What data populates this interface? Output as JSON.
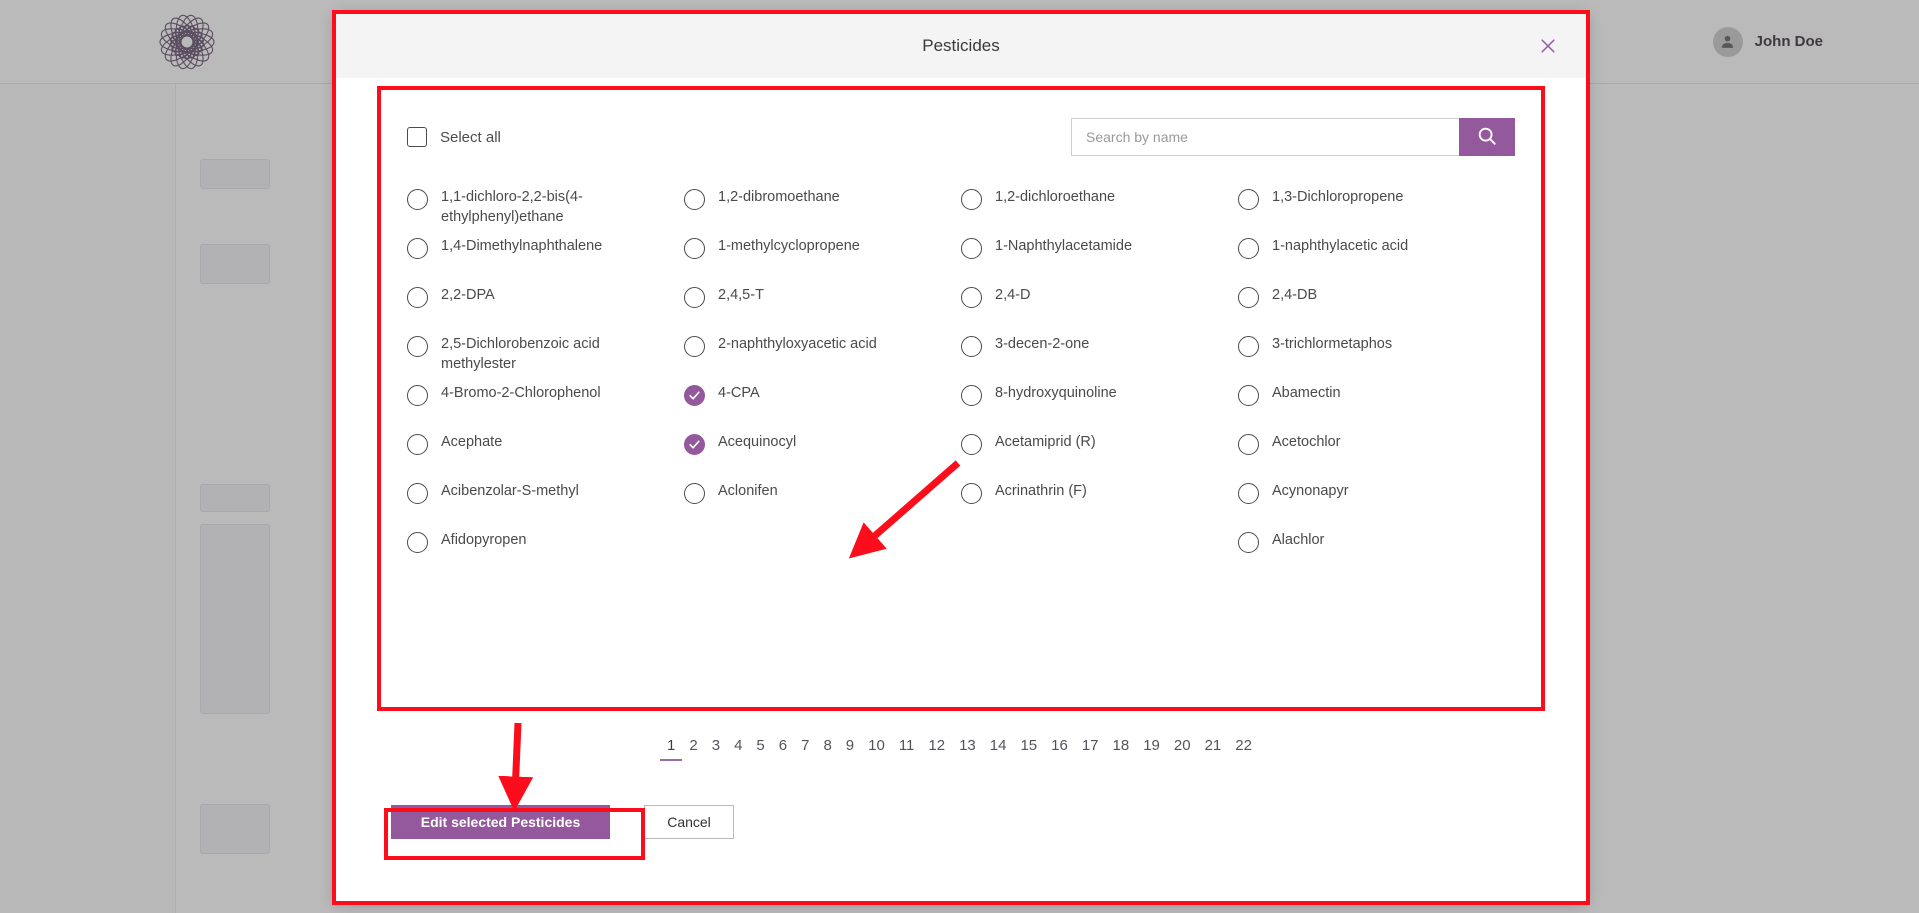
{
  "background": {
    "logo_icon": "flower-mandala-logo",
    "user": {
      "name": "John Doe",
      "avatar_icon": "person-avatar-icon"
    }
  },
  "modal": {
    "title": "Pesticides",
    "close_icon": "close-icon",
    "toolbar": {
      "select_all_label": "Select all",
      "select_all_checked": false,
      "search": {
        "placeholder": "Search by name",
        "value": "",
        "button_icon": "search-icon"
      }
    },
    "options": [
      {
        "label": "1,1-dichloro-2,2-bis(4-ethylphenyl)ethane",
        "checked": false
      },
      {
        "label": "1,2-dibromoethane",
        "checked": false
      },
      {
        "label": "1,2-dichloroethane",
        "checked": false
      },
      {
        "label": "1,3-Dichloropropene",
        "checked": false
      },
      {
        "label": "1,4-Dimethylnaphthalene",
        "checked": false
      },
      {
        "label": "1-methylcyclopropene",
        "checked": false
      },
      {
        "label": "1-Naphthylacetamide",
        "checked": false
      },
      {
        "label": "1-naphthylacetic acid",
        "checked": false
      },
      {
        "label": "2,2-DPA",
        "checked": false
      },
      {
        "label": "2,4,5-T",
        "checked": false
      },
      {
        "label": "2,4-D",
        "checked": false
      },
      {
        "label": "2,4-DB",
        "checked": false
      },
      {
        "label": "2,5-Dichlorobenzoic acid methylester",
        "checked": false
      },
      {
        "label": "2-naphthyloxyacetic acid",
        "checked": false
      },
      {
        "label": "3-decen-2-one",
        "checked": false
      },
      {
        "label": "3-trichlormetaphos",
        "checked": false
      },
      {
        "label": "4-Bromo-2-Chlorophenol",
        "checked": false
      },
      {
        "label": "4-CPA",
        "checked": true
      },
      {
        "label": "8-hydroxyquinoline",
        "checked": false
      },
      {
        "label": "Abamectin",
        "checked": false
      },
      {
        "label": "Acephate",
        "checked": false
      },
      {
        "label": "Acequinocyl",
        "checked": true
      },
      {
        "label": "Acetamiprid (R)",
        "checked": false
      },
      {
        "label": "Acetochlor",
        "checked": false
      },
      {
        "label": "Acibenzolar-S-methyl",
        "checked": false
      },
      {
        "label": "Aclonifen",
        "checked": false
      },
      {
        "label": "Acrinathrin (F)",
        "checked": false
      },
      {
        "label": "Acynonapyr",
        "checked": false
      },
      {
        "label": "Afidopyropen",
        "checked": false
      },
      {
        "label": "",
        "checked": false
      },
      {
        "label": "",
        "checked": false
      },
      {
        "label": "Alachlor",
        "checked": false
      }
    ],
    "pagination": {
      "pages": [
        "1",
        "2",
        "3",
        "4",
        "5",
        "6",
        "7",
        "8",
        "9",
        "10",
        "11",
        "12",
        "13",
        "14",
        "15",
        "16",
        "17",
        "18",
        "19",
        "20",
        "21",
        "22"
      ],
      "active": "1"
    },
    "footer": {
      "edit_label": "Edit selected Pesticides",
      "cancel_label": "Cancel"
    }
  },
  "colors": {
    "accent_purple": "#94599c",
    "annotation_red": "#fc0d1b",
    "header_grey": "#f4f4f4"
  }
}
